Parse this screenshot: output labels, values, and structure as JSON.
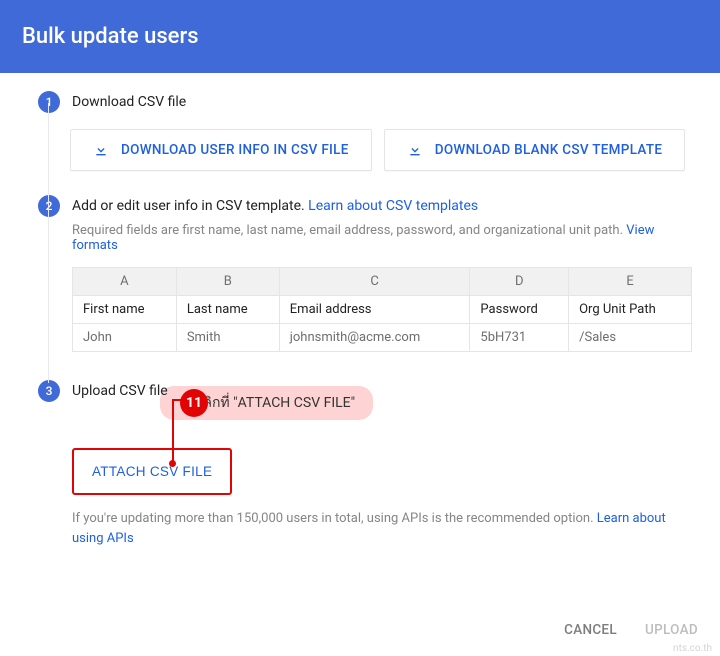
{
  "header": {
    "title": "Bulk update users"
  },
  "steps": {
    "s1": {
      "num": "1",
      "title": "Download CSV file",
      "btn1": "DOWNLOAD USER INFO IN CSV FILE",
      "btn2": "DOWNLOAD BLANK CSV TEMPLATE"
    },
    "s2": {
      "num": "2",
      "title_prefix": "Add or edit user info in CSV template. ",
      "title_link": "Learn about CSV templates",
      "subtext_prefix": "Required fields are first name, last name, email address, password, and organizational unit path. ",
      "subtext_link": "View formats",
      "cols_letters": [
        "A",
        "B",
        "C",
        "D",
        "E"
      ],
      "headers": [
        "First name",
        "Last name",
        "Email address",
        "Password",
        "Org Unit Path"
      ],
      "row": [
        "John",
        "Smith",
        "johnsmith@acme.com",
        "5bH731",
        "/Sales"
      ]
    },
    "s3": {
      "num": "3",
      "title": "Upload CSV file",
      "attach_label": "ATTACH CSV FILE",
      "callout_num": "11",
      "callout_text": "คลิกที่ \"ATTACH CSV FILE\"",
      "api_prefix": "If you're updating more than 150,000 users in total, using APIs is the recommended option. ",
      "api_link": "Learn about using APIs"
    }
  },
  "footer": {
    "cancel": "CANCEL",
    "upload": "UPLOAD"
  },
  "watermark": "nts.co.th"
}
